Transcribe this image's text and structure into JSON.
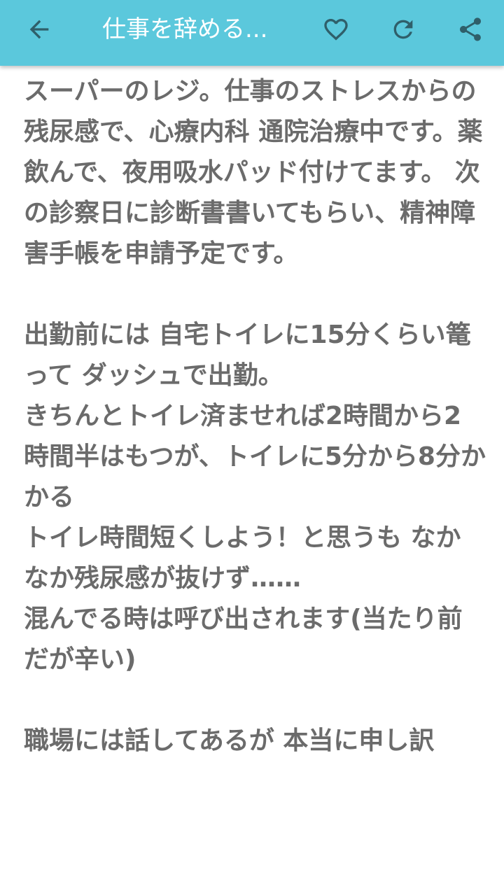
{
  "app_bar": {
    "title": "仕事を辞める...",
    "background_color": "#5bc8dc",
    "icons": {
      "back": "arrow-left-icon",
      "favorite": "heart-outline-icon",
      "refresh": "refresh-icon",
      "share": "share-icon"
    }
  },
  "article": {
    "text_color": "#6b6b6b",
    "body": "スーパーのレジ。仕事のストレスからの残尿感で、心療内科 通院治療中です。薬飲んで、夜用吸水パッド付けてます。 次の診察日に診断書書いてもらい、精神障害手帳を申請予定です。\n\n出勤前には 自宅トイレに15分くらい篭って ダッシュで出勤。\nきちんとトイレ済ませれば2時間から2時間半はもつが、トイレに5分から8分かかる\nトイレ時間短くしよう！と思うも なかなか残尿感が抜けず……\n混んでる時は呼び出されます(当たり前だが辛い)\n\n職場には話してあるが 本当に申し訳"
  }
}
